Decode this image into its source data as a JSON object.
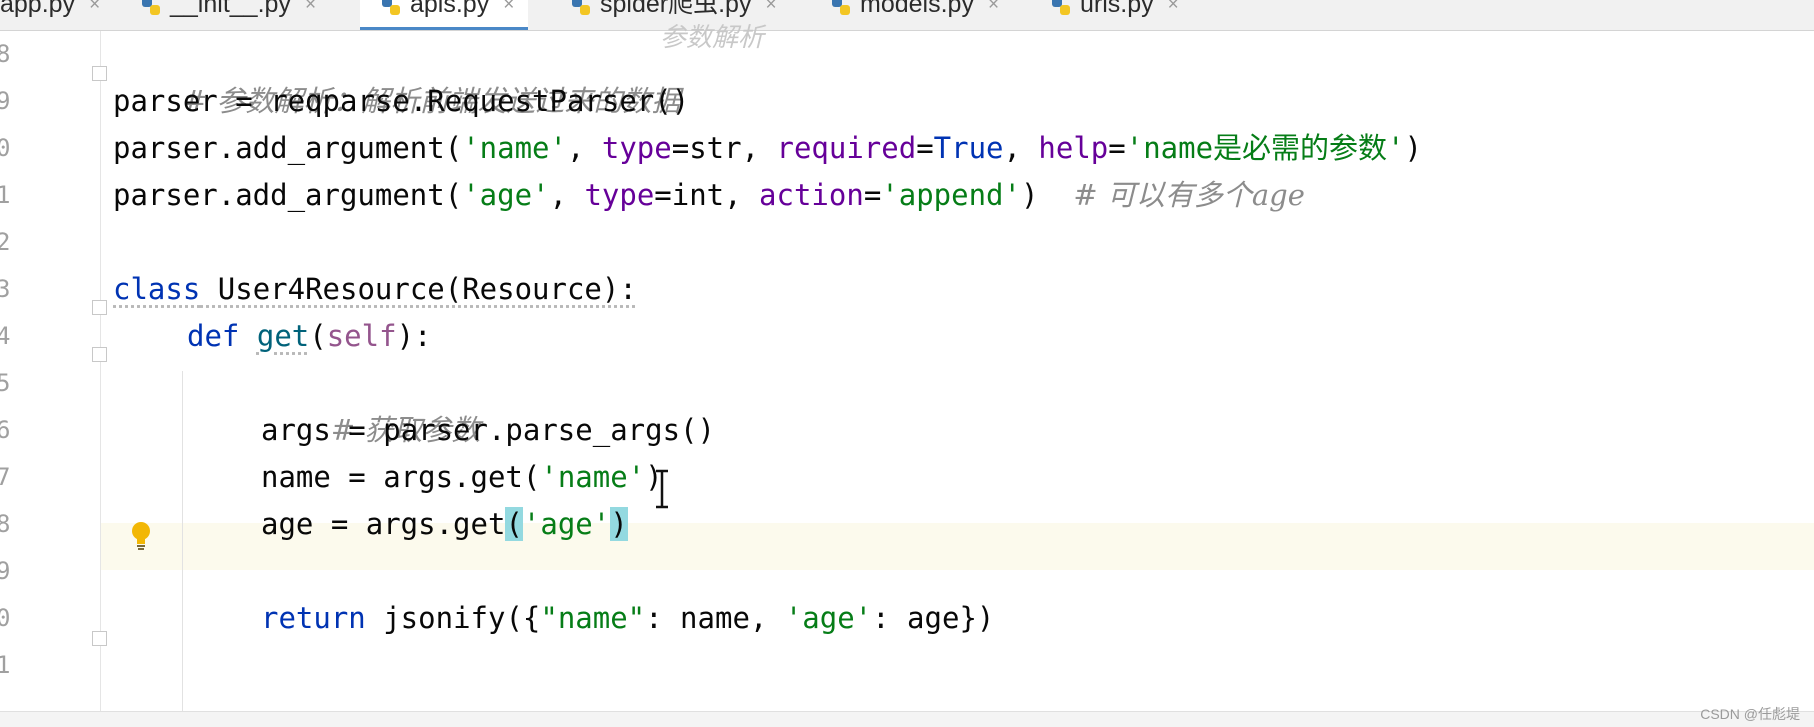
{
  "tabs": [
    {
      "label": "app.py",
      "close": "×"
    },
    {
      "label": "__init__.py",
      "close": "×"
    },
    {
      "label": "apis.py",
      "close": "×"
    },
    {
      "label": "spider爬虫.py",
      "close": "×"
    },
    {
      "label": "models.py",
      "close": "×"
    },
    {
      "label": "urls.py",
      "close": "×"
    }
  ],
  "active_tab": "apis.py",
  "icons": {
    "file_type": "python-file-icon",
    "hint": "lightbulb-icon",
    "cursor": "text-cursor-icon"
  },
  "colors": {
    "comment": "#8c8c8c",
    "string": "#067d17",
    "keyword": "#0033b3",
    "param": "#660099",
    "current_line": "#fcfaed",
    "brace_highlight": "#93d9e0"
  },
  "top_clipped_comment": "参数解析",
  "line_numbers": [
    "8",
    "9",
    "0",
    "1",
    "2",
    "3",
    "4",
    "5",
    "6",
    "7",
    "8",
    "9",
    "0",
    "1"
  ],
  "code": {
    "l8": "# 参数解析：解析前端发送过来的数据",
    "l9": "parser = reqparse.RequestParser()",
    "l10": {
      "a": "parser.add_argument(",
      "s1": "'name'",
      "b": ", ",
      "k1": "type",
      "c": "=str, ",
      "k2": "required",
      "d": "=",
      "t": "True",
      "e": ", ",
      "k3": "help",
      "f": "=",
      "s2": "'name是必需的参数'",
      "g": ")"
    },
    "l11": {
      "a": "parser.add_argument(",
      "s1": "'age'",
      "b": ", ",
      "k1": "type",
      "c": "=int, ",
      "k2": "action",
      "d": "=",
      "s2": "'append'",
      "e": ")  ",
      "cm": "# 可以有多个age"
    },
    "l13": {
      "kw": "class",
      "rest": " User4Resource(Resource):"
    },
    "l14": {
      "kw": "def",
      "sp": " ",
      "fn": "get",
      "p1": "(",
      "self": "self",
      "p2": "):"
    },
    "l15": "# 获取参数",
    "l16": "args = parser.parse_args()",
    "l17": {
      "a": "name = args.get(",
      "s": "'name'",
      "b": ")"
    },
    "l18": {
      "a": "age = args.get",
      "lp": "(",
      "s": "'age'",
      "rp": ")"
    },
    "l20": {
      "kw": "return",
      "a": " jsonify({",
      "s1": "\"name\"",
      "b": ": name, ",
      "s2": "'age'",
      "c": ": age})"
    }
  },
  "watermark": "CSDN @任彪堤"
}
